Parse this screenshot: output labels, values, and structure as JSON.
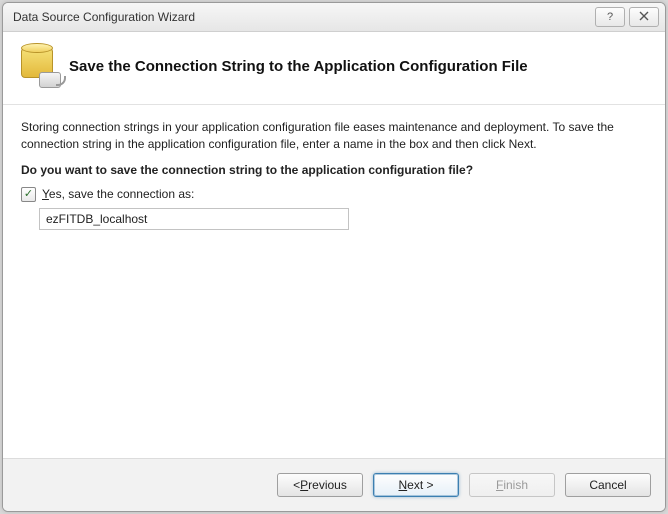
{
  "window": {
    "title": "Data Source Configuration Wizard"
  },
  "header": {
    "title": "Save the Connection String to the Application Configuration File"
  },
  "body": {
    "description": "Storing connection strings in your application configuration file eases maintenance and deployment. To save the connection string in the application configuration file, enter a name in the box and then click Next.",
    "question": "Do you want to save the connection string to the application configuration file?",
    "checkbox_prefix": "Y",
    "checkbox_rest": "es, save the connection as:",
    "checkbox_checked": true,
    "connection_name": "ezFITDB_localhost"
  },
  "footer": {
    "previous_prefix": "< ",
    "previous_u": "P",
    "previous_rest": "revious",
    "next_u": "N",
    "next_rest": "ext >",
    "finish_u": "F",
    "finish_rest": "inish",
    "cancel": "Cancel"
  }
}
